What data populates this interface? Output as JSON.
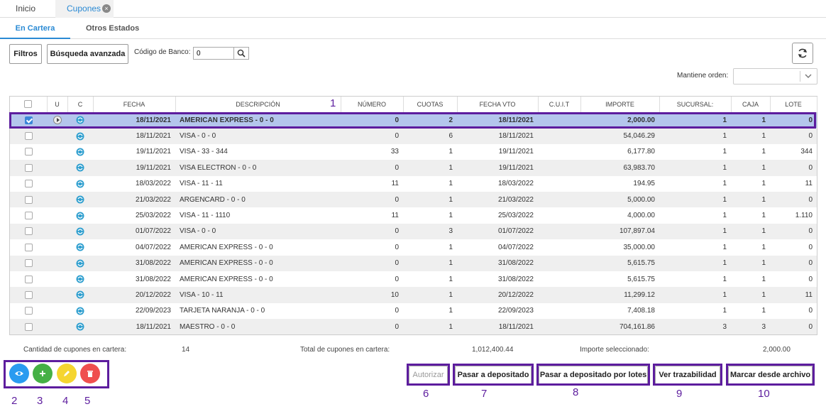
{
  "top_tabs": {
    "inicio": "Inicio",
    "cupones": "Cupones"
  },
  "sub_tabs": {
    "cartera": "En Cartera",
    "otros": "Otros Estados"
  },
  "toolbar": {
    "filtros": "Filtros",
    "busqueda": "Búsqueda avanzada",
    "codigo_label": "Código de Banco:",
    "codigo_value": "0"
  },
  "orden": {
    "label": "Mantiene orden:",
    "value": ""
  },
  "table": {
    "headers": [
      "",
      "U",
      "C",
      "FECHA",
      "DESCRIPCIÓN",
      "NÚMERO",
      "CUOTAS",
      "FECHA VTO",
      "C.U.I.T",
      "IMPORTE",
      "SUCURSAL:",
      "CAJA",
      "LOTE"
    ],
    "rows": [
      {
        "fecha": "18/11/2021",
        "desc": "AMERICAN EXPRESS - 0 - 0",
        "numero": "0",
        "cuotas": "2",
        "vto": "18/11/2021",
        "cuit": "",
        "importe": "2,000.00",
        "sucursal": "1",
        "caja": "1",
        "lote": "0"
      },
      {
        "fecha": "18/11/2021",
        "desc": "VISA - 0 - 0",
        "numero": "0",
        "cuotas": "6",
        "vto": "18/11/2021",
        "cuit": "",
        "importe": "54,046.29",
        "sucursal": "1",
        "caja": "1",
        "lote": "0"
      },
      {
        "fecha": "19/11/2021",
        "desc": "VISA - 33 - 344",
        "numero": "33",
        "cuotas": "1",
        "vto": "19/11/2021",
        "cuit": "",
        "importe": "6,177.80",
        "sucursal": "1",
        "caja": "1",
        "lote": "344"
      },
      {
        "fecha": "19/11/2021",
        "desc": "VISA ELECTRON - 0 - 0",
        "numero": "0",
        "cuotas": "1",
        "vto": "19/11/2021",
        "cuit": "",
        "importe": "63,983.70",
        "sucursal": "1",
        "caja": "1",
        "lote": "0"
      },
      {
        "fecha": "18/03/2022",
        "desc": "VISA - 11 - 11",
        "numero": "11",
        "cuotas": "1",
        "vto": "18/03/2022",
        "cuit": "",
        "importe": "194.95",
        "sucursal": "1",
        "caja": "1",
        "lote": "11"
      },
      {
        "fecha": "21/03/2022",
        "desc": "ARGENCARD - 0 - 0",
        "numero": "0",
        "cuotas": "1",
        "vto": "21/03/2022",
        "cuit": "",
        "importe": "5,000.00",
        "sucursal": "1",
        "caja": "1",
        "lote": "0"
      },
      {
        "fecha": "25/03/2022",
        "desc": "VISA - 11 - 1110",
        "numero": "11",
        "cuotas": "1",
        "vto": "25/03/2022",
        "cuit": "",
        "importe": "4,000.00",
        "sucursal": "1",
        "caja": "1",
        "lote": "1.110"
      },
      {
        "fecha": "01/07/2022",
        "desc": "VISA - 0 - 0",
        "numero": "0",
        "cuotas": "3",
        "vto": "01/07/2022",
        "cuit": "",
        "importe": "107,897.04",
        "sucursal": "1",
        "caja": "1",
        "lote": "0"
      },
      {
        "fecha": "04/07/2022",
        "desc": "AMERICAN EXPRESS - 0 - 0",
        "numero": "0",
        "cuotas": "1",
        "vto": "04/07/2022",
        "cuit": "",
        "importe": "35,000.00",
        "sucursal": "1",
        "caja": "1",
        "lote": "0"
      },
      {
        "fecha": "31/08/2022",
        "desc": "AMERICAN EXPRESS - 0 - 0",
        "numero": "0",
        "cuotas": "1",
        "vto": "31/08/2022",
        "cuit": "",
        "importe": "5,615.75",
        "sucursal": "1",
        "caja": "1",
        "lote": "0"
      },
      {
        "fecha": "31/08/2022",
        "desc": "AMERICAN EXPRESS - 0 - 0",
        "numero": "0",
        "cuotas": "1",
        "vto": "31/08/2022",
        "cuit": "",
        "importe": "5,615.75",
        "sucursal": "1",
        "caja": "1",
        "lote": "0"
      },
      {
        "fecha": "20/12/2022",
        "desc": "VISA - 10 - 11",
        "numero": "10",
        "cuotas": "1",
        "vto": "20/12/2022",
        "cuit": "",
        "importe": "11,299.12",
        "sucursal": "1",
        "caja": "1",
        "lote": "11"
      },
      {
        "fecha": "22/09/2023",
        "desc": "TARJETA NARANJA - 0 - 0",
        "numero": "0",
        "cuotas": "1",
        "vto": "22/09/2023",
        "cuit": "",
        "importe": "7,408.18",
        "sucursal": "1",
        "caja": "1",
        "lote": "0"
      },
      {
        "fecha": "18/11/2021",
        "desc": "MAESTRO - 0 - 0",
        "numero": "0",
        "cuotas": "1",
        "vto": "18/11/2021",
        "cuit": "",
        "importe": "704,161.86",
        "sucursal": "3",
        "caja": "3",
        "lote": "0"
      }
    ]
  },
  "summary": {
    "cantidad_label": "Cantidad de cupones en cartera:",
    "cantidad_value": "14",
    "total_label": "Total de cupones en cartera:",
    "total_value": "1,012,400.44",
    "importe_label": "Importe seleccionado:",
    "importe_value": "2,000.00"
  },
  "actions": {
    "autorizar": "Autorizar",
    "pasar": "Pasar a depositado",
    "pasar_lotes": "Pasar a depositado por lotes",
    "trazabilidad": "Ver trazabilidad",
    "marcar": "Marcar desde archivo"
  },
  "icons": {
    "view": "eye-icon",
    "add": "plus-icon",
    "edit": "pencil-icon",
    "delete": "trash-icon",
    "refresh": "refresh-icon",
    "search": "search-icon"
  },
  "colors": {
    "accent": "#2a8ad4",
    "selected_row": "#b4c6ec",
    "annotation": "#5d1d9e",
    "view": "#2a9bf0",
    "add": "#45b045",
    "edit": "#f5d530",
    "delete": "#ef4f4f"
  },
  "annotations": [
    "1",
    "2",
    "3",
    "4",
    "5",
    "6",
    "7",
    "8",
    "9",
    "10"
  ]
}
